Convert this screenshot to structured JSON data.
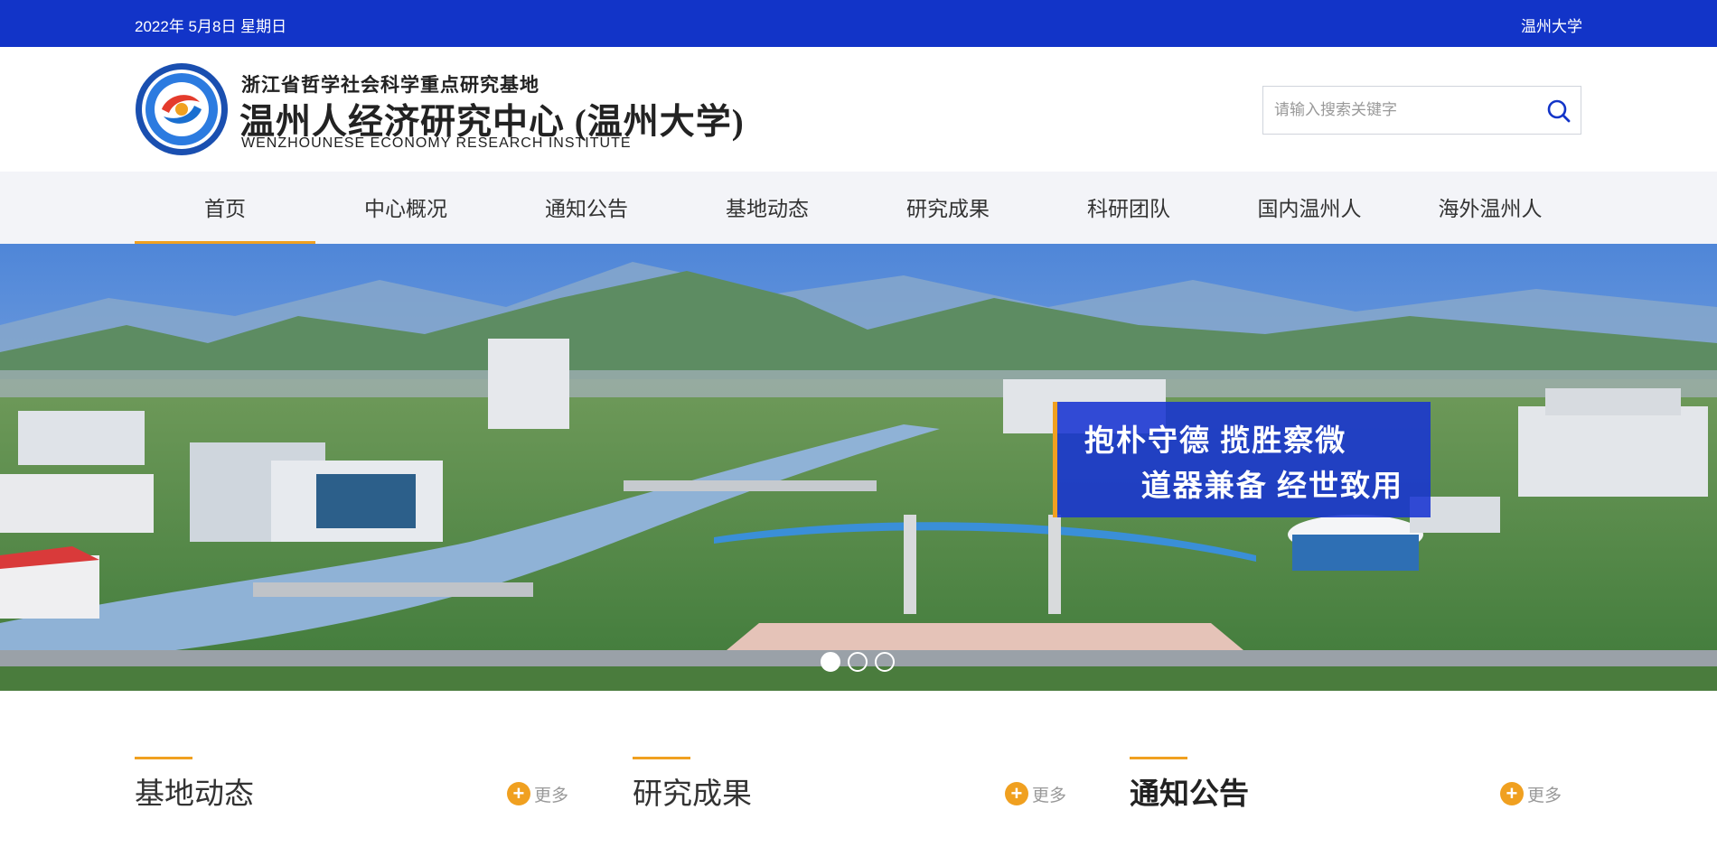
{
  "topbar": {
    "date": "2022年 5月8日 星期日",
    "university": "温州大学"
  },
  "header": {
    "subtitle": "浙江省哲学社会科学重点研究基地",
    "title": "温州人经济研究中心 (温州大学)",
    "title_en": "WENZHOUNESE ECONOMY RESEARCH INSTITUTE",
    "logo_icon": "institute-seal-logo"
  },
  "search": {
    "placeholder": "请输入搜索关键字",
    "icon": "search-icon"
  },
  "nav": {
    "items": [
      {
        "label": "首页",
        "active": true
      },
      {
        "label": "中心概况"
      },
      {
        "label": "通知公告"
      },
      {
        "label": "基地动态"
      },
      {
        "label": "研究成果"
      },
      {
        "label": "科研团队"
      },
      {
        "label": "国内温州人"
      },
      {
        "label": "海外温州人"
      }
    ]
  },
  "banner": {
    "slogan_line1": "抱朴守德  揽胜察微",
    "slogan_line2": "道器兼备  经世致用",
    "slides": 3,
    "active_slide": 1
  },
  "sections": [
    {
      "title": "基地动态",
      "more": "更多"
    },
    {
      "title": "研究成果",
      "more": "更多"
    },
    {
      "title": "通知公告",
      "more": "更多"
    }
  ],
  "colors": {
    "topbar": "#1234c8",
    "accent": "#f0a020",
    "nav_bg": "#f3f4f8",
    "slogan_bg": "#1834d2"
  }
}
